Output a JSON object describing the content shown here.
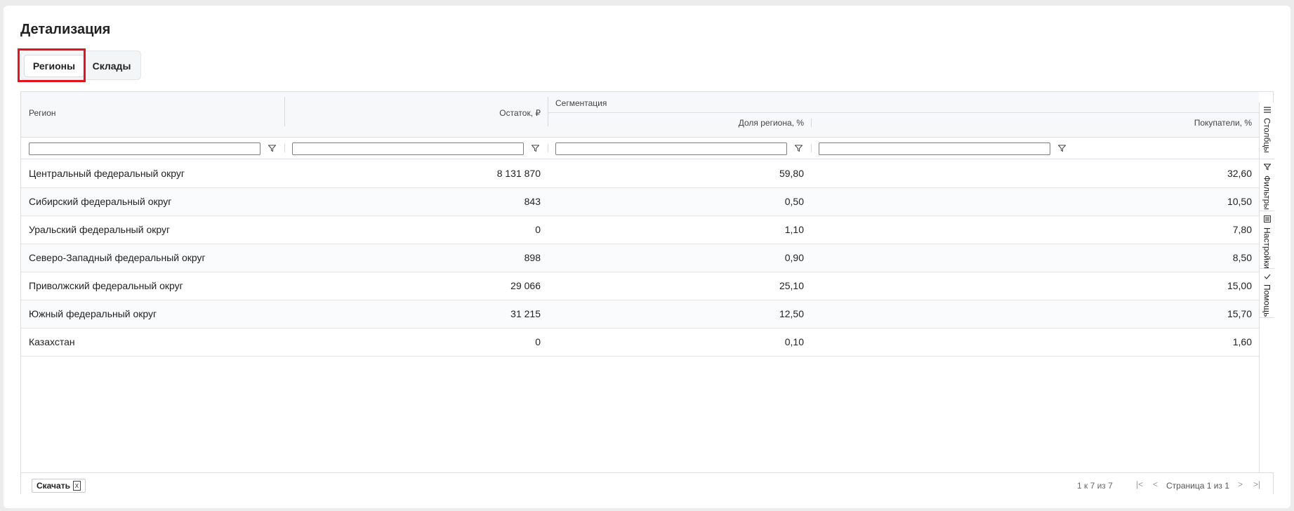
{
  "title": "Детализация",
  "tabs": [
    {
      "label": "Регионы",
      "active": true
    },
    {
      "label": "Склады",
      "active": false
    }
  ],
  "table": {
    "group_header": "Сегментация",
    "columns": [
      "Регион",
      "Остаток, ₽",
      "Доля региона, %",
      "Покупатели, %"
    ],
    "rows": [
      [
        "Центральный федеральный округ",
        "8 131 870",
        "59,80",
        "32,60"
      ],
      [
        "Сибирский федеральный округ",
        "843",
        "0,50",
        "10,50"
      ],
      [
        "Уральский федеральный округ",
        "0",
        "1,10",
        "7,80"
      ],
      [
        "Северо-Западный федеральный округ",
        "898",
        "0,90",
        "8,50"
      ],
      [
        "Приволжский федеральный округ",
        "29 066",
        "25,10",
        "15,00"
      ],
      [
        "Южный федеральный округ",
        "31 215",
        "12,50",
        "15,70"
      ],
      [
        "Казахстан",
        "0",
        "0,10",
        "1,60"
      ]
    ]
  },
  "side_panel": [
    {
      "label": "Столбцы",
      "icon": "columns-icon"
    },
    {
      "label": "Фильтры",
      "icon": "filter-icon"
    },
    {
      "label": "Настройки",
      "icon": "settings-icon"
    },
    {
      "label": "Помощь",
      "icon": "check-icon"
    }
  ],
  "footer": {
    "download_label": "Скачать",
    "download_icon": "excel-icon",
    "summary": "1 к 7 из 7",
    "page_label": "Страница 1 из 1"
  },
  "colors": {
    "highlight": "#e0141e",
    "header_bg": "#f7f8fa"
  }
}
